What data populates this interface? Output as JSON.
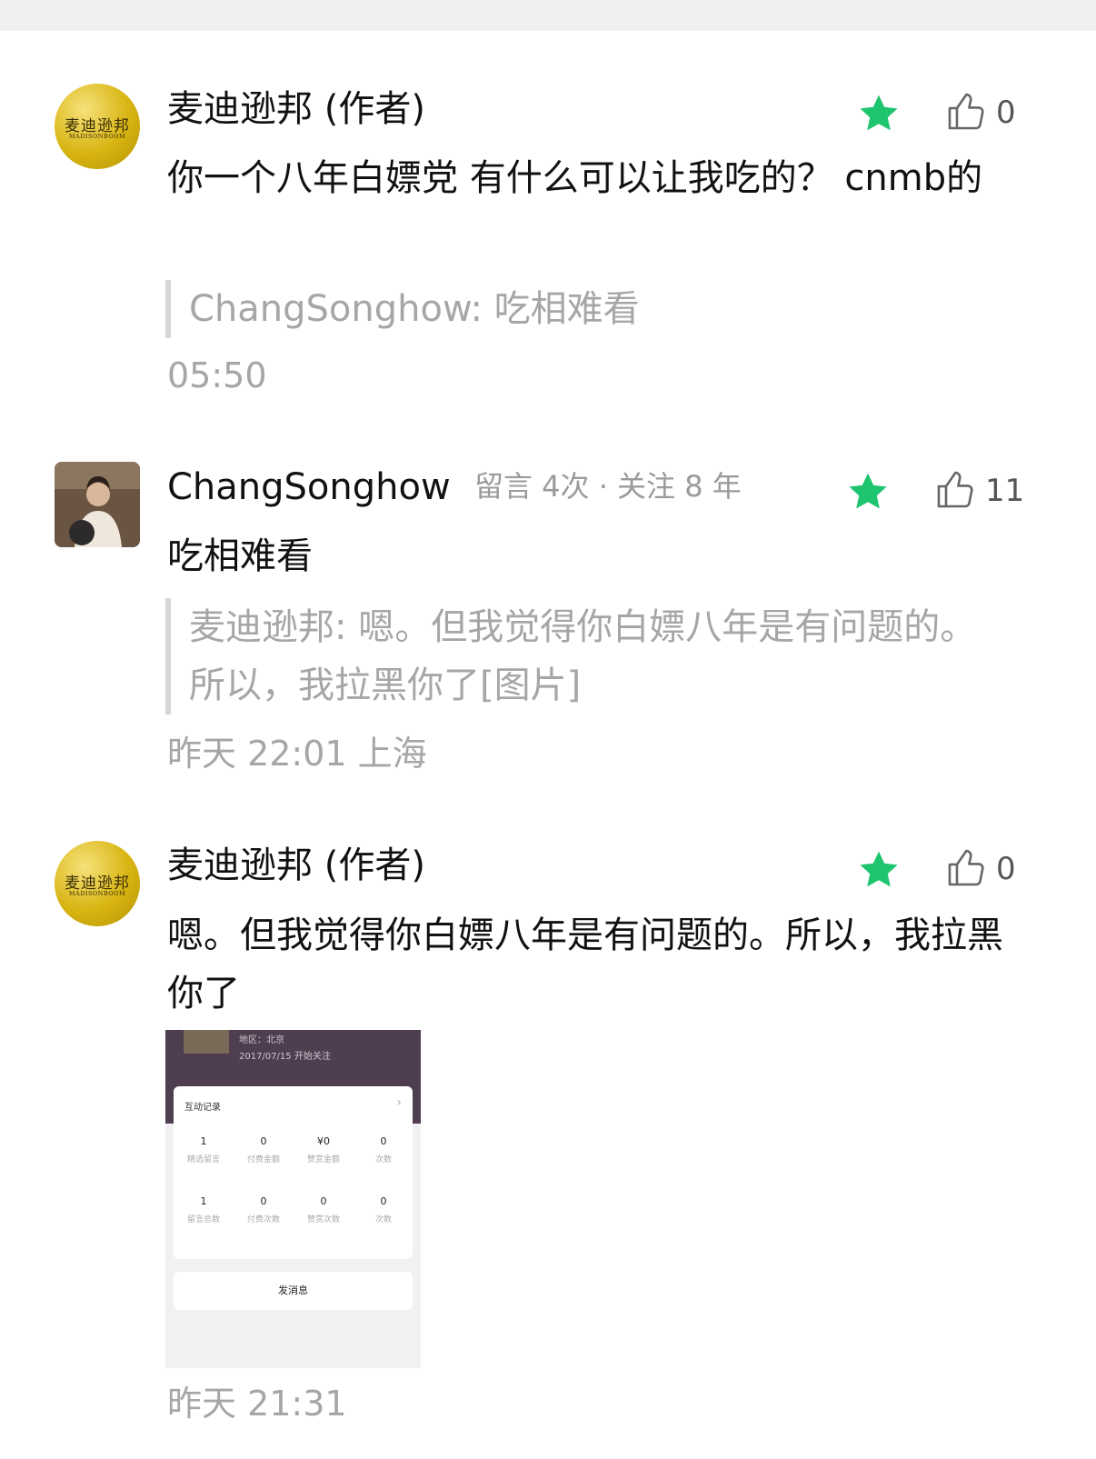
{
  "comments": [
    {
      "author": "麦迪逊邦 (作者)",
      "avatar_text": "麦迪逊邦",
      "avatar_sub": "MADISONBOOM",
      "text": "你一个八年白嫖党 有什么可以让我吃的？ cnmb的",
      "quote": "ChangSonghow: 吃相难看",
      "time": "05:50",
      "likes": "0"
    },
    {
      "author": "ChangSonghow",
      "meta": "留言 4次 · 关注 8 年",
      "text": "吃相难看",
      "quote": "麦迪逊邦: 嗯。但我觉得你白嫖八年是有问题的。所以，我拉黑你了[图片]",
      "time": "昨天 22:01  上海",
      "likes": "11"
    },
    {
      "author": "麦迪逊邦 (作者)",
      "avatar_text": "麦迪逊邦",
      "avatar_sub": "MADISONBOOM",
      "text": "嗯。但我觉得你白嫖八年是有问题的。所以，我拉黑你了",
      "time": "昨天 21:31",
      "likes": "0"
    }
  ],
  "screenshot": {
    "region": "地区：北京",
    "follow_date": "2017/07/15 开始关注",
    "section_title": "互动记录",
    "chevron": "›",
    "stats": [
      {
        "value": "1",
        "label": "精选留言"
      },
      {
        "value": "0",
        "label": "付费金额"
      },
      {
        "value": "¥0",
        "label": "赞赏金额"
      },
      {
        "value": "0",
        "label": "次数"
      },
      {
        "value": "1",
        "label": "留言总数"
      },
      {
        "value": "0",
        "label": "付费次数"
      },
      {
        "value": "0",
        "label": "赞赏次数"
      },
      {
        "value": "0",
        "label": "次数"
      }
    ],
    "button": "发消息"
  },
  "colors": {
    "star": "#1fc46e",
    "gold": "#d7b411",
    "muted": "#a6a6a6"
  },
  "icons": [
    "star-icon",
    "thumbs-up-icon"
  ]
}
